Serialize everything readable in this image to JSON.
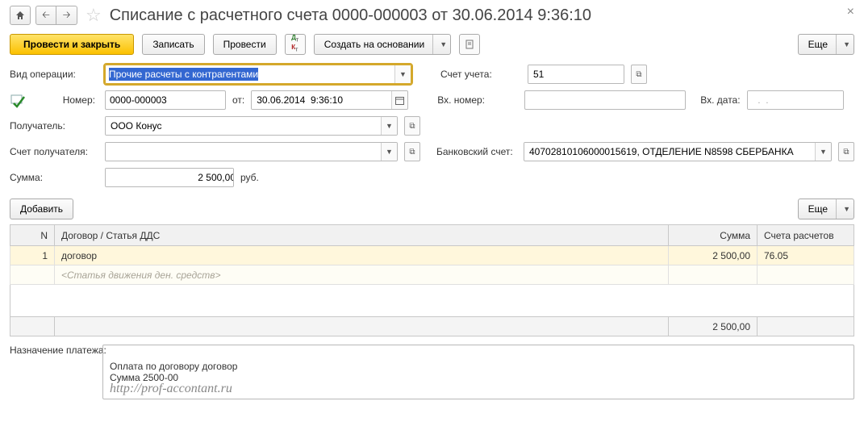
{
  "header": {
    "title": "Списание с расчетного счета 0000-000003 от 30.06.2014 9:36:10"
  },
  "toolbar": {
    "post_close": "Провести и закрыть",
    "write": "Записать",
    "post": "Провести",
    "create_based": "Создать на основании",
    "more": "Еще"
  },
  "form": {
    "operation_type_label": "Вид операции:",
    "operation_type": "Прочие расчеты с контрагентами",
    "account_label": "Счет учета:",
    "account": "51",
    "number_label": "Номер:",
    "number": "0000-000003",
    "from_label": "от:",
    "date": "30.06.2014  9:36:10",
    "ext_number_label": "Вх. номер:",
    "ext_number": "",
    "ext_date_label": "Вх. дата:",
    "ext_date": "  .  .    ",
    "recipient_label": "Получатель:",
    "recipient": "ООО Конус",
    "recipient_account_label": "Счет получателя:",
    "recipient_account": "",
    "bank_account_label": "Банковский счет:",
    "bank_account": "40702810106000015619, ОТДЕЛЕНИЕ N8598 СБЕРБАНКА",
    "sum_label": "Сумма:",
    "sum": "2 500,00",
    "currency": "руб."
  },
  "table": {
    "add_btn": "Добавить",
    "more_btn": "Еще",
    "columns": {
      "n": "N",
      "contract": "Договор / Статья ДДС",
      "sum": "Сумма",
      "accounts": "Счета расчетов"
    },
    "rows": [
      {
        "n": "1",
        "contract": "договор",
        "dds_placeholder": "<Статья движения ден. средств>",
        "sum": "2 500,00",
        "account": "76.05"
      }
    ],
    "total_sum": "2 500,00"
  },
  "purpose": {
    "label": "Назначение платежа:",
    "text": "Оплата по договору договор\nСумма 2500-00"
  },
  "watermark": "http://prof-accontant.ru"
}
